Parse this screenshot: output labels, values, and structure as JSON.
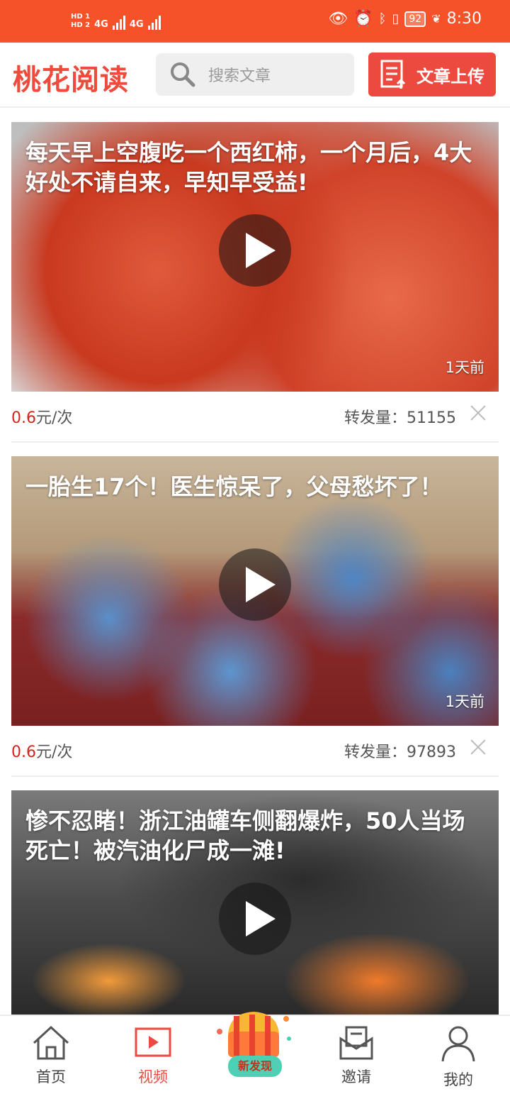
{
  "status_bar": {
    "time": "8:30",
    "battery": "92",
    "signal_a": "4G",
    "signal_b": "4G",
    "hd_a": "HD 1",
    "hd_b": "HD 2"
  },
  "header": {
    "app_name": "桃花阅读",
    "search_placeholder": "搜索文章",
    "upload_label": "文章上传"
  },
  "feed": [
    {
      "title": "每天早上空腹吃一个西红柿，一个月后，4大好处不请自来，早知早受益!",
      "age": "1天前",
      "price_value": "0.6",
      "price_unit": "元/次",
      "forward_label": "转发量：",
      "forward_count": "51155"
    },
    {
      "title": "一胎生17个！医生惊呆了，父母愁坏了！",
      "age": "1天前",
      "price_value": "0.6",
      "price_unit": "元/次",
      "forward_label": "转发量：",
      "forward_count": "97893"
    },
    {
      "title": "惨不忍睹！浙江油罐车侧翻爆炸，50人当场死亡！被汽油化尸成一滩!",
      "age": "",
      "price_value": "",
      "price_unit": "",
      "forward_label": "",
      "forward_count": ""
    }
  ],
  "tabs": [
    {
      "label": "首页",
      "icon": "home-icon"
    },
    {
      "label": "视频",
      "icon": "video-icon",
      "active": true
    },
    {
      "label": "新发现",
      "icon": "treasure-chest-icon"
    },
    {
      "label": "邀请",
      "icon": "envelope-icon"
    },
    {
      "label": "我的",
      "icon": "person-icon"
    }
  ],
  "colors": {
    "status_bar": "#f5522a",
    "brand": "#ee4b3d",
    "accent_red": "#ec4a3e",
    "price_red": "#d2251e"
  }
}
